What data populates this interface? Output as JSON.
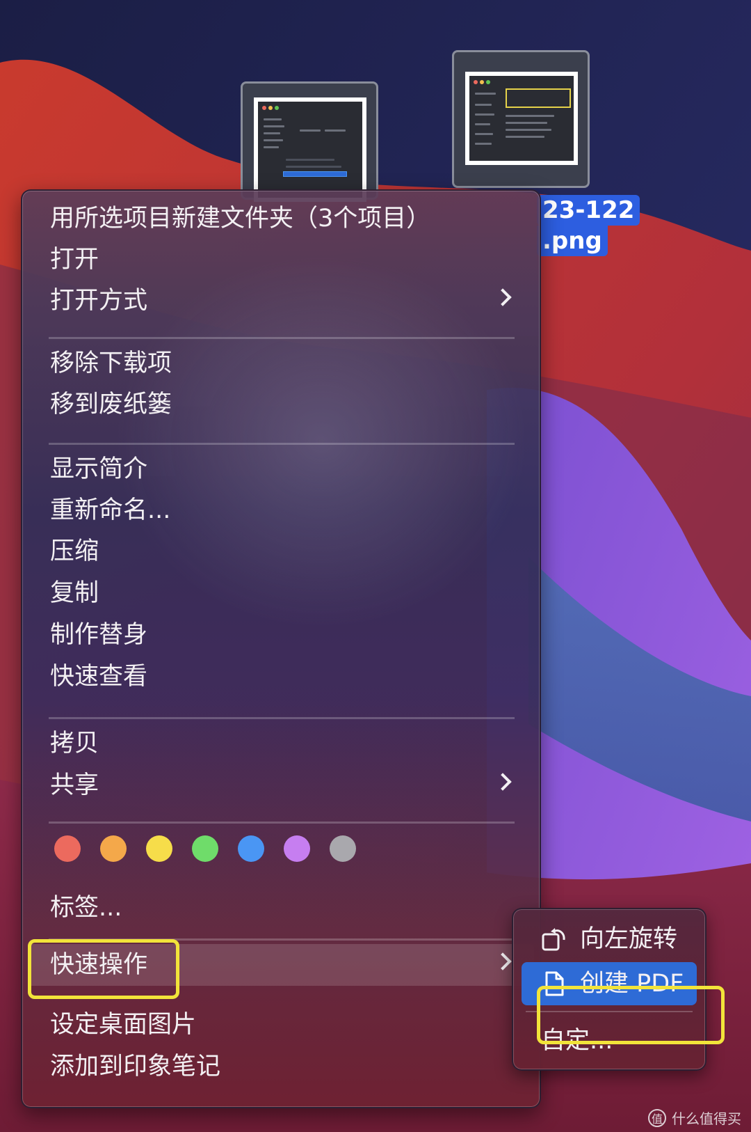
{
  "desktop": {
    "file_label_lines": [
      "23-122",
      ".png"
    ]
  },
  "context_menu": {
    "groups": [
      [
        {
          "label": "用所选项目新建文件夹（3个项目）",
          "submenu": false
        },
        {
          "label": "打开",
          "submenu": false
        },
        {
          "label": "打开方式",
          "submenu": true
        }
      ],
      [
        {
          "label": "移除下载项",
          "submenu": false
        },
        {
          "label": "移到废纸篓",
          "submenu": false
        }
      ],
      [
        {
          "label": "显示简介",
          "submenu": false
        },
        {
          "label": "重新命名...",
          "submenu": false
        },
        {
          "label": "压缩",
          "submenu": false
        },
        {
          "label": "复制",
          "submenu": false
        },
        {
          "label": "制作替身",
          "submenu": false
        },
        {
          "label": "快速查看",
          "submenu": false
        }
      ],
      [
        {
          "label": "拷贝",
          "submenu": false
        },
        {
          "label": "共享",
          "submenu": true
        }
      ]
    ],
    "tag_colors": [
      {
        "name": "red",
        "color": "#ec6a5e"
      },
      {
        "name": "orange",
        "color": "#f4a84a"
      },
      {
        "name": "yellow",
        "color": "#f6dd4a"
      },
      {
        "name": "green",
        "color": "#6fdc6a"
      },
      {
        "name": "blue",
        "color": "#4a96f4"
      },
      {
        "name": "purple",
        "color": "#c67ef0"
      },
      {
        "name": "gray",
        "color": "#a9a8ad"
      }
    ],
    "tags_label": "标签...",
    "quick_actions_label": "快速操作",
    "bottom_items": [
      {
        "label": "设定桌面图片"
      },
      {
        "label": "添加到印象笔记"
      }
    ]
  },
  "quick_actions_submenu": {
    "items": [
      {
        "label": "向左旋转",
        "icon": "rotate-left-icon",
        "selected": false
      },
      {
        "label": "创建 PDF",
        "icon": "document-icon",
        "selected": true
      }
    ],
    "customize_label": "自定..."
  },
  "highlight_color": "#f2e43a",
  "watermark": {
    "logo": "值",
    "text": "什么值得买"
  }
}
